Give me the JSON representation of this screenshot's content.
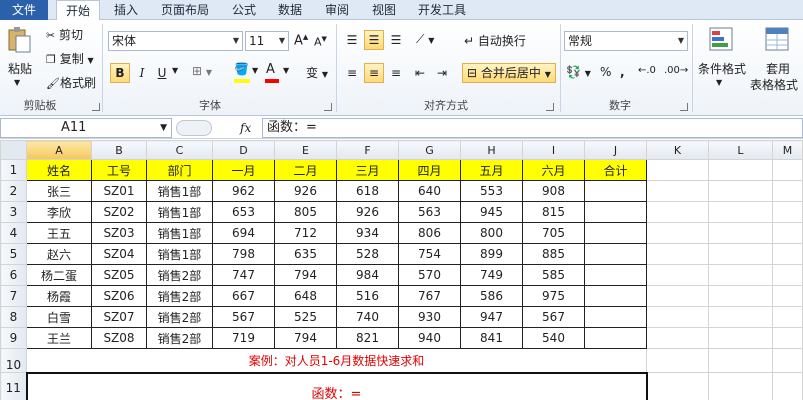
{
  "tabs": [
    "文件",
    "开始",
    "插入",
    "页面布局",
    "公式",
    "数据",
    "审阅",
    "视图",
    "开发工具"
  ],
  "clipboard": {
    "paste": "粘贴",
    "cut": "剪切",
    "copy": "复制",
    "format_painter": "格式刷",
    "label": "剪贴板"
  },
  "font": {
    "name": "宋体",
    "size": "11",
    "bold": "B",
    "italic": "I",
    "underline": "U",
    "grow": "A",
    "shrink": "A",
    "fill_color": "#ffff00",
    "font_color": "#ff0000",
    "phonetic": "变",
    "label": "字体"
  },
  "alignment": {
    "wrap_text": "自动换行",
    "merge_center": "合并后居中",
    "label": "对齐方式"
  },
  "number": {
    "format": "常规",
    "percent": "%",
    "comma": ",",
    "label": "数字"
  },
  "styles": {
    "conditional": "条件格式",
    "table_format_1": "套用",
    "table_format_2": "表格格式"
  },
  "formula_bar": {
    "name_box": "A11",
    "fx": "fx",
    "content": "函数：="
  },
  "columns": [
    "A",
    "B",
    "C",
    "D",
    "E",
    "F",
    "G",
    "H",
    "I",
    "J",
    "K",
    "L",
    "M"
  ],
  "header_row": [
    "姓名",
    "工号",
    "部门",
    "一月",
    "二月",
    "三月",
    "四月",
    "五月",
    "六月",
    "合计"
  ],
  "rows": [
    [
      "张三",
      "SZ01",
      "销售1部",
      "962",
      "926",
      "618",
      "640",
      "553",
      "908",
      ""
    ],
    [
      "李欣",
      "SZ02",
      "销售1部",
      "653",
      "805",
      "926",
      "563",
      "945",
      "815",
      ""
    ],
    [
      "王五",
      "SZ03",
      "销售1部",
      "694",
      "712",
      "934",
      "806",
      "800",
      "705",
      ""
    ],
    [
      "赵六",
      "SZ04",
      "销售1部",
      "798",
      "635",
      "528",
      "754",
      "899",
      "885",
      ""
    ],
    [
      "杨二蛋",
      "SZ05",
      "销售2部",
      "747",
      "794",
      "984",
      "570",
      "749",
      "585",
      ""
    ],
    [
      "杨霞",
      "SZ06",
      "销售2部",
      "667",
      "648",
      "516",
      "767",
      "586",
      "975",
      ""
    ],
    [
      "白雪",
      "SZ07",
      "销售2部",
      "567",
      "525",
      "740",
      "930",
      "947",
      "567",
      ""
    ],
    [
      "王兰",
      "SZ08",
      "销售2部",
      "719",
      "794",
      "821",
      "940",
      "841",
      "540",
      ""
    ]
  ],
  "row_numbers": [
    "1",
    "2",
    "3",
    "4",
    "5",
    "6",
    "7",
    "8",
    "9",
    "10",
    "11"
  ],
  "note": "案例：对人员1-6月数据快速求和",
  "box_text": "函数：="
}
